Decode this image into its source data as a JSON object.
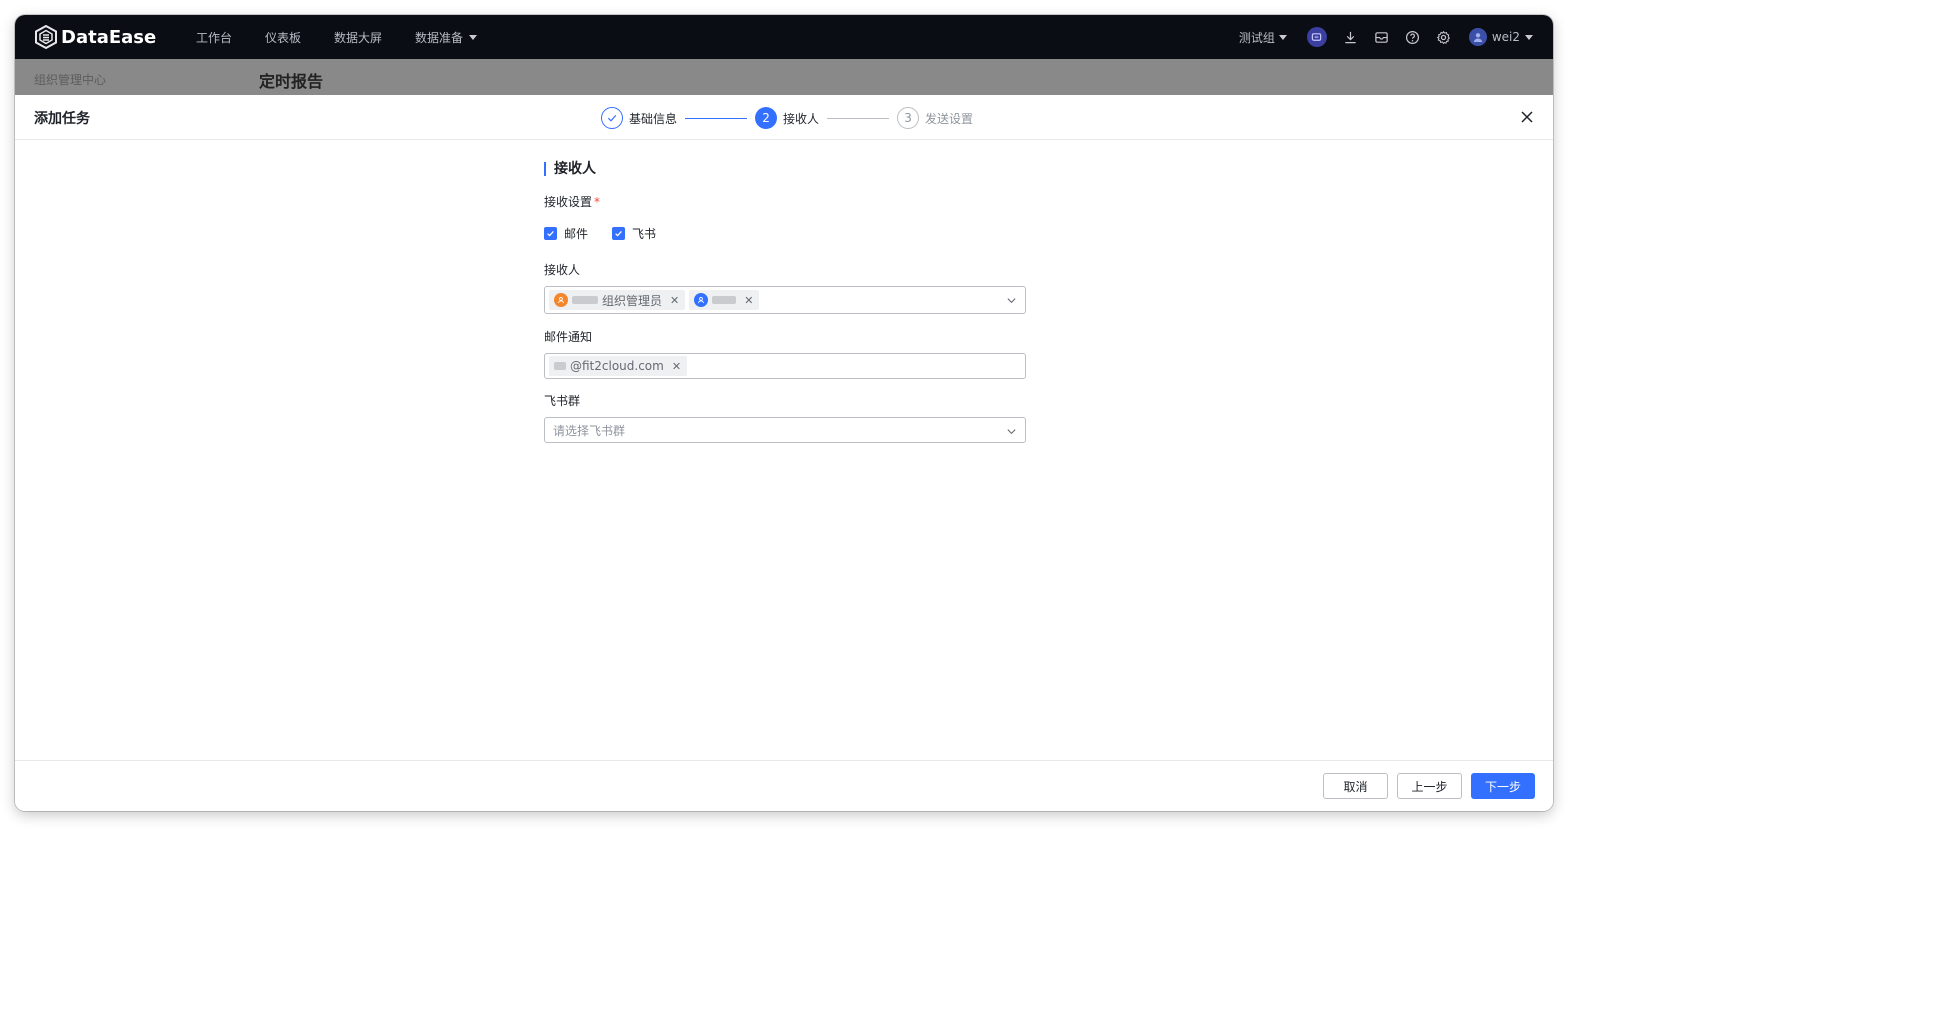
{
  "app": {
    "brand": "DataEase"
  },
  "topnav": {
    "items": [
      {
        "label": "工作台",
        "has_dropdown": false
      },
      {
        "label": "仪表板",
        "has_dropdown": false
      },
      {
        "label": "数据大屏",
        "has_dropdown": false
      },
      {
        "label": "数据准备",
        "has_dropdown": true
      }
    ],
    "org": "测试组",
    "user": "wei2",
    "tools": [
      "message-icon",
      "download-icon",
      "inbox-icon",
      "help-icon",
      "settings-icon"
    ]
  },
  "subbar": {
    "breadcrumb": "组织管理中心",
    "title": "定时报告"
  },
  "dialog": {
    "title": "添加任务",
    "steps": [
      {
        "number": "1",
        "label": "基础信息",
        "state": "done"
      },
      {
        "number": "2",
        "label": "接收人",
        "state": "active"
      },
      {
        "number": "3",
        "label": "发送设置",
        "state": "wait"
      }
    ],
    "form": {
      "section_title": "接收人",
      "receive_settings": {
        "label": "接收设置",
        "required_mark": "*",
        "options": [
          {
            "label": "邮件",
            "checked": true
          },
          {
            "label": "飞书",
            "checked": true
          }
        ]
      },
      "recipients": {
        "label": "接收人",
        "tags": [
          {
            "text": "组织管理员",
            "icon_color": "#f5862b",
            "kind": "role"
          },
          {
            "text": "",
            "icon_color": "#3370ff",
            "kind": "user"
          }
        ]
      },
      "email": {
        "label": "邮件通知",
        "tags": [
          {
            "text": "@fit2cloud.com"
          }
        ]
      },
      "feishu_group": {
        "label": "飞书群",
        "placeholder": "请选择飞书群"
      }
    },
    "footer": {
      "cancel": "取消",
      "prev": "上一步",
      "next": "下一步"
    }
  },
  "colors": {
    "accent": "#3370ff",
    "topbar": "#0b0d14",
    "role_icon": "#f5862b"
  }
}
